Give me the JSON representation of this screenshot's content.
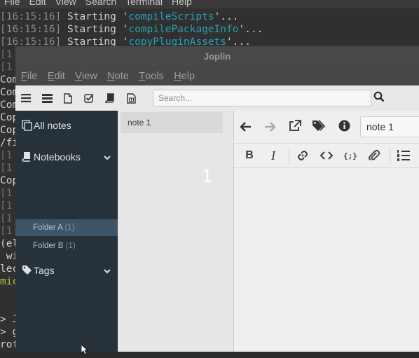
{
  "terminal": {
    "menu": [
      "File",
      "Edit",
      "View",
      "Search",
      "Terminal",
      "Help"
    ],
    "lines": [
      {
        "ts": "[16:15:16]",
        "text": " Starting '",
        "name": "compileScripts",
        "tail": "'..."
      },
      {
        "ts": "[16:15:16]",
        "text": " Starting '",
        "name": "compilePackageInfo",
        "tail": "'..."
      },
      {
        "ts": "[16:15:16]",
        "text": " Starting '",
        "name": "copyPluginAssets",
        "tail": "'..."
      }
    ],
    "left_fragments": [
      "[1",
      "[1",
      "Com",
      "Com",
      "Com",
      "Cop",
      "Cop",
      "/fi",
      "[1",
      "[1",
      "Cop",
      "[1",
      "[1",
      "[1",
      "[1",
      "(el",
      " wi",
      "lec",
      "mic",
      "",
      "> J",
      "> g",
      "rof"
    ]
  },
  "window": {
    "title": "Joplin",
    "menu": [
      {
        "first": "F",
        "rest": "ile"
      },
      {
        "first": "E",
        "rest": "dit"
      },
      {
        "first": "V",
        "rest": "iew"
      },
      {
        "first": "N",
        "rest": "ote"
      },
      {
        "first": "T",
        "rest": "ools"
      },
      {
        "first": "H",
        "rest": "elp"
      }
    ]
  },
  "toolbar": {
    "search_placeholder": "Search...",
    "icons": [
      "sidebar-toggle-icon",
      "notelist-toggle-icon",
      "new-note-icon",
      "new-todo-icon",
      "new-notebook-icon",
      "layout-icon",
      "search-icon"
    ]
  },
  "sidebar": {
    "all_notes": "All notes",
    "notebooks": "Notebooks",
    "folders": [
      {
        "name": "Folder A",
        "count": "(1)",
        "selected": true
      },
      {
        "name": "Folder B",
        "count": "(1)",
        "selected": false
      }
    ],
    "tags": "Tags",
    "colors": {
      "background": "#263139",
      "selected": "#3e5568"
    }
  },
  "notelist": {
    "notes": [
      {
        "title": "note 1"
      }
    ]
  },
  "overlay_number": "1",
  "editor": {
    "note_title": "note 1",
    "markdown_toolbar": [
      "B",
      "I"
    ]
  }
}
